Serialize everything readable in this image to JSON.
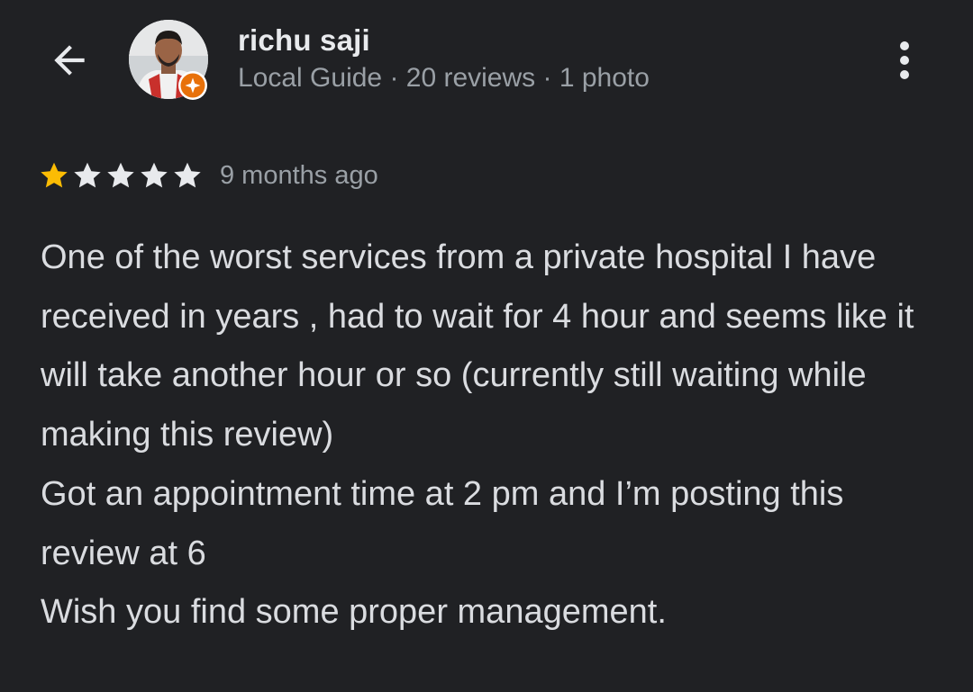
{
  "header": {
    "back_icon": "arrow-back-icon",
    "user": {
      "name": "richu saji",
      "meta": "Local Guide · 20 reviews · 1 photo",
      "avatar_icon": "profile-photo",
      "badge_icon": "local-guide-badge-icon"
    },
    "more_icon": "more-vert-icon"
  },
  "review": {
    "rating": 1,
    "max_rating": 5,
    "time": "9 months ago",
    "text": "One of the worst services from a private hospital I have received in years , had to wait for 4 hour and seems like it will take another hour or so (currently still waiting while making this review)\nGot an appointment time at 2 pm and I’m posting this review at 6\nWish you find some proper management."
  },
  "colors": {
    "background": "#202124",
    "primary_text": "#e8eaed",
    "secondary_text": "#9aa0a6",
    "star_filled": "#fbbc04",
    "star_empty": "#e8eaed",
    "badge": "#e8710a"
  }
}
